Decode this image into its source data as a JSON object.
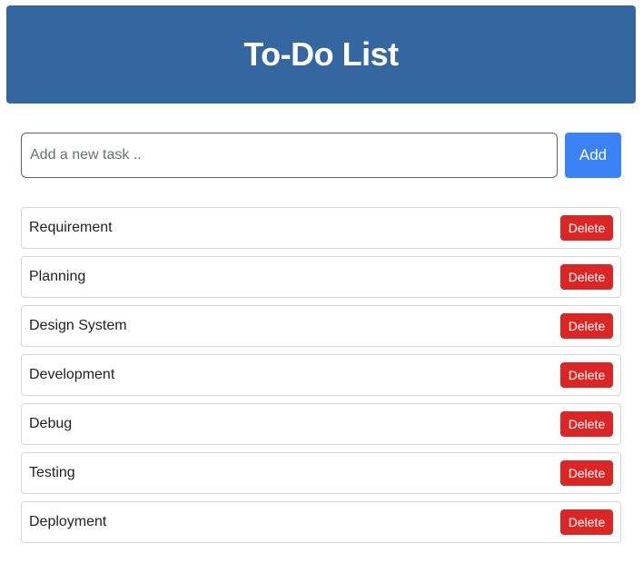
{
  "header": {
    "title": "To-Do List"
  },
  "new_task": {
    "placeholder": "Add a new task ..",
    "value": "",
    "add_label": "Add"
  },
  "tasks": [
    {
      "text": "Requirement",
      "delete_label": "Delete"
    },
    {
      "text": "Planning",
      "delete_label": "Delete"
    },
    {
      "text": "Design System",
      "delete_label": "Delete"
    },
    {
      "text": "Development",
      "delete_label": "Delete"
    },
    {
      "text": "Debug",
      "delete_label": "Delete"
    },
    {
      "text": "Testing",
      "delete_label": "Delete"
    },
    {
      "text": "Deployment",
      "delete_label": "Delete"
    }
  ],
  "colors": {
    "header_bg": "#34669f",
    "add_button": "#3b82f6",
    "delete_button": "#dc2626"
  }
}
